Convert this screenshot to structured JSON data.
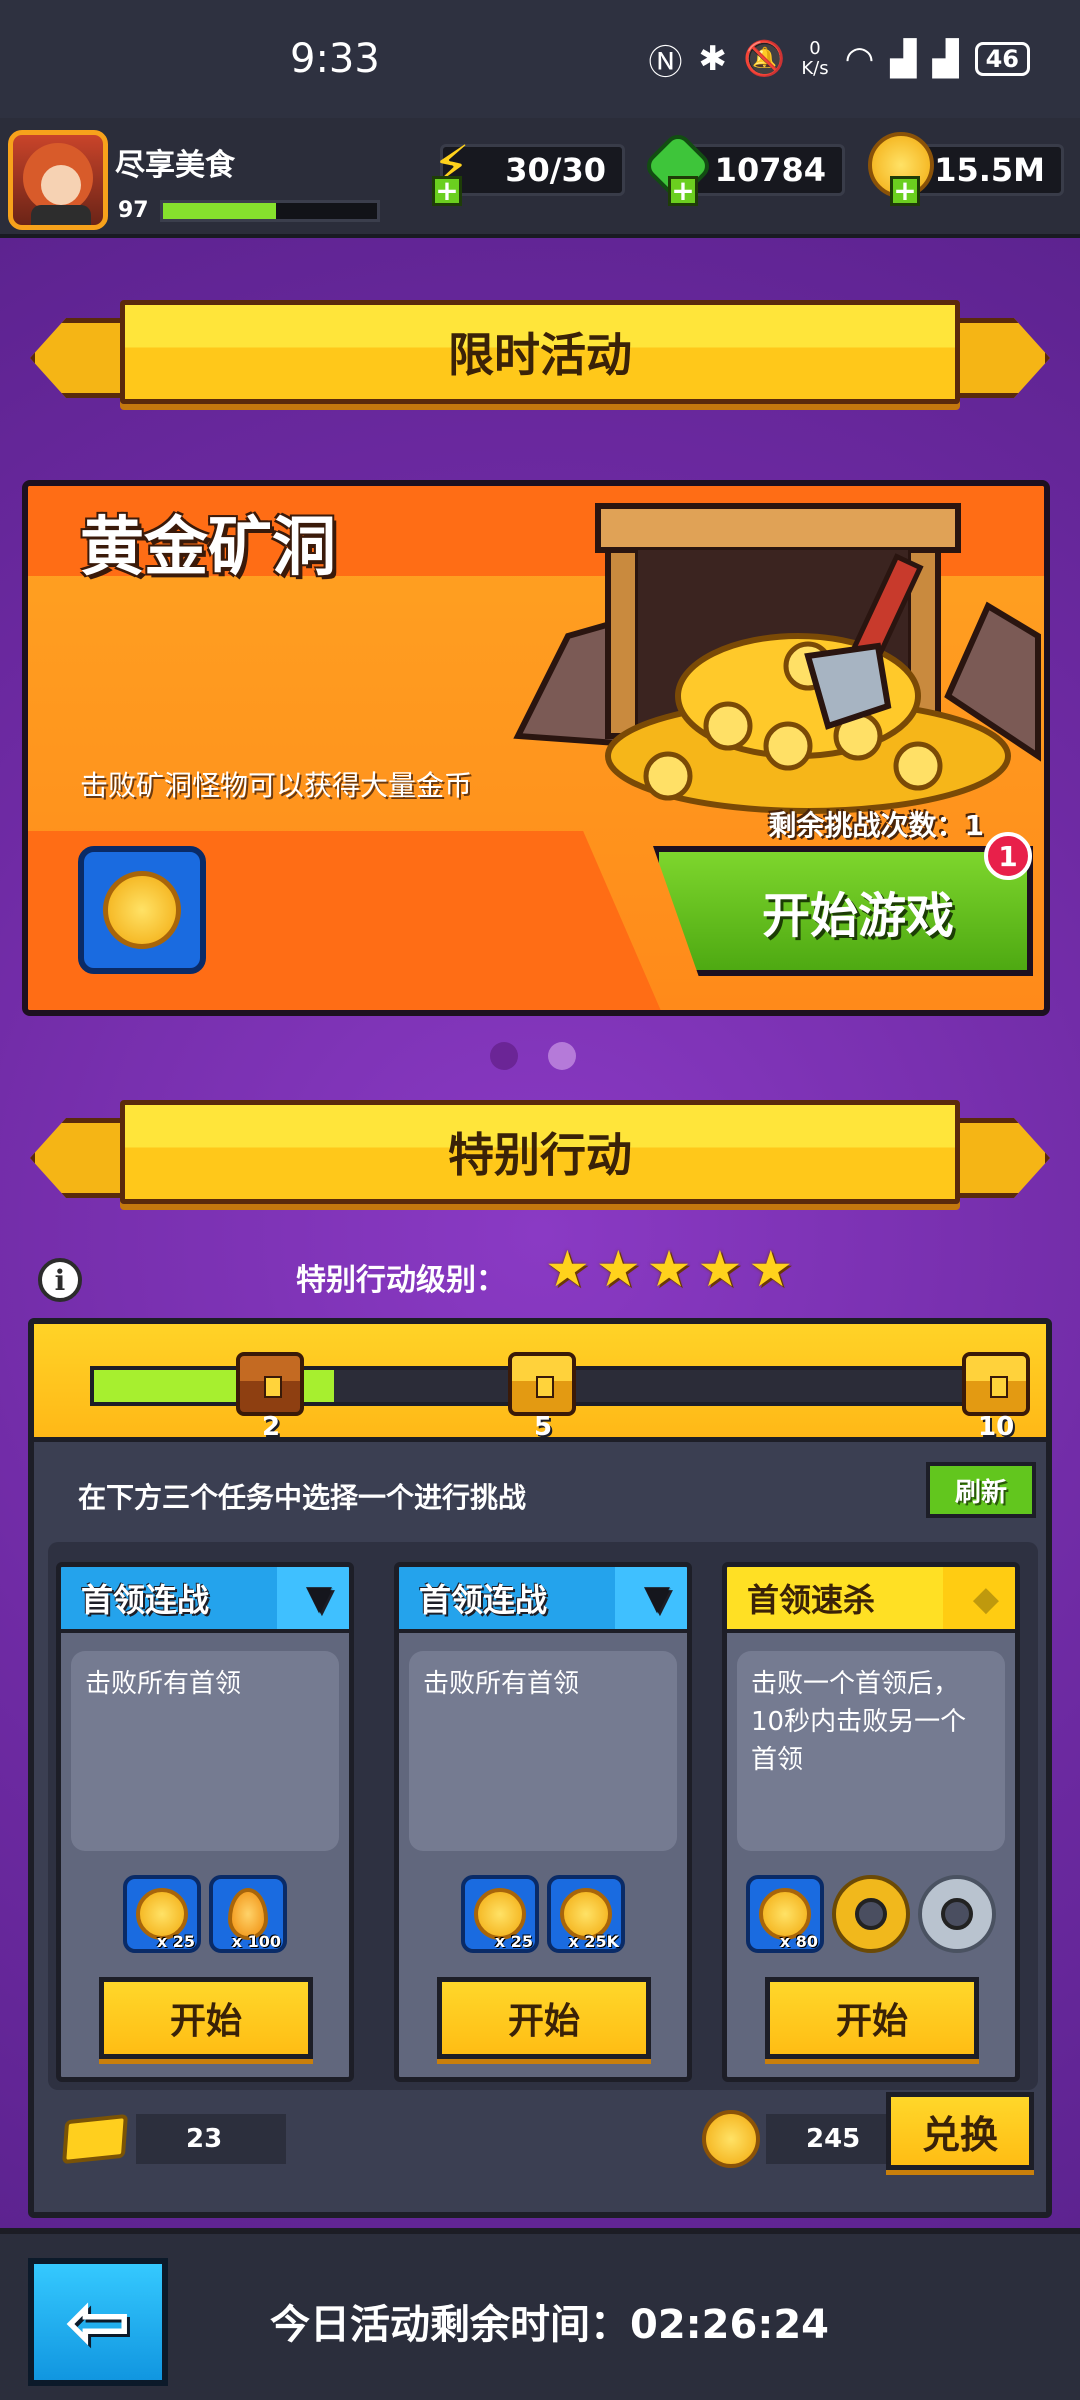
{
  "status_bar": {
    "time": "9:33",
    "net_speed_value": "0",
    "net_speed_unit": "K/s",
    "battery": "46",
    "icons": [
      "nfc-icon",
      "bluetooth-icon",
      "mute-icon",
      "wifi-icon",
      "signal-4g-icon",
      "signal-5g-icon"
    ]
  },
  "player": {
    "name": "尽享美食",
    "level": "97",
    "xp_fraction": 0.53
  },
  "resources": {
    "energy": "30/30",
    "gems": "10784",
    "coins": "15.5M"
  },
  "limited_event": {
    "banner_title": "限时活动",
    "title": "黄金矿洞",
    "description": "击败矿洞怪物可以获得大量金币",
    "remaining_challenges": "剩余挑战次数：1",
    "start_button": "开始游戏",
    "badge": "1",
    "page_count": 2,
    "active_page": 2
  },
  "special_action": {
    "banner_title": "特别行动",
    "level_label": "特别行动级别：",
    "stars": 5,
    "progress_fraction": 0.26,
    "milestones": [
      "2",
      "5",
      "10"
    ],
    "choose_text": "在下方三个任务中选择一个进行挑战",
    "refresh_button": "刷新",
    "tasks": [
      {
        "title": "首领连战",
        "description": "击败所有首领",
        "rewards": [
          {
            "icon": "gold-token-icon",
            "qty": "x 25"
          },
          {
            "icon": "orange-drop-icon",
            "qty": "x 100"
          }
        ],
        "start_button": "开始"
      },
      {
        "title": "首领连战",
        "description": "击败所有首领",
        "rewards": [
          {
            "icon": "gold-token-icon",
            "qty": "x 25"
          },
          {
            "icon": "gold-coin-icon",
            "qty": "x 25K"
          }
        ],
        "start_button": "开始"
      },
      {
        "title": "首领速杀",
        "description": "击败一个首领后，10秒内击败另一个首领",
        "rewards": [
          {
            "icon": "gold-token-icon",
            "qty": "x 80"
          },
          {
            "icon": "gold-gear-icon",
            "qty": ""
          },
          {
            "icon": "grey-gear-icon",
            "qty": ""
          }
        ],
        "start_button": "开始"
      }
    ],
    "tickets": "23",
    "tokens": "245",
    "exchange_button": "兑换"
  },
  "bottom": {
    "remaining_time": "今日活动剩余时间：02:26:24"
  },
  "colors": {
    "background": "#7a2fb0",
    "banner_yellow": "#ffc81a",
    "start_green": "#4ea912",
    "event_orange": "#ff8a1a"
  }
}
